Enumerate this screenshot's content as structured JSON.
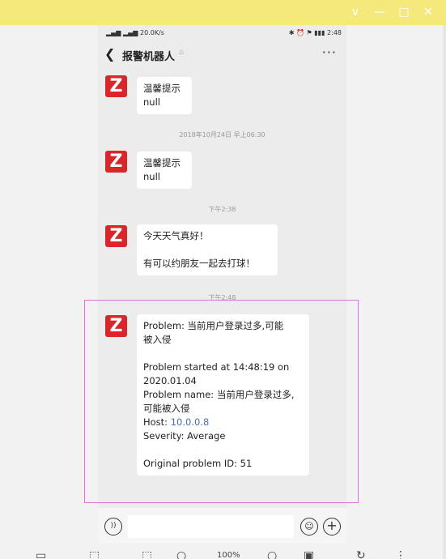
{
  "window": {
    "controls": [
      "∨",
      "—",
      "□",
      "✕"
    ]
  },
  "status_bar": {
    "left": "▂▄▆ ▂▄▆ 20.0K/s",
    "right": "✱ ⏰ ⚑ ▮▮▮ 2:48"
  },
  "chat": {
    "back": "❮",
    "title": "报警机器人",
    "mute_icon": "⌂",
    "more": "···",
    "avatar_letter": "Z"
  },
  "messages": [
    {
      "lines": [
        "温馨提示",
        "null"
      ]
    },
    {
      "timestamp": "2018年10月24日 早上06:30"
    },
    {
      "lines": [
        "温馨提示",
        "null"
      ]
    },
    {
      "timestamp": "下午2:38"
    },
    {
      "lines": [
        "今天天气真好！",
        "",
        "有可以约朋友一起去打球！"
      ]
    },
    {
      "timestamp": "下午2:48"
    },
    {
      "l1": "Problem: 当前用户登录过多,可能",
      "l2": "被入侵",
      "l3": "Problem started at 14:48:19 on",
      "l4": "2020.01.04",
      "l5": "Problem name: 当前用户登录过多,",
      "l6": "可能被入侵",
      "host_label": "Host: ",
      "host_value": "10.0.0.8",
      "severity": "Severity: Average",
      "original_id": "Original problem ID: 51"
    }
  ],
  "input_bar": {
    "voice_icon": "))",
    "emoji_icon": "☺",
    "plus_icon": "+"
  },
  "toolbar": {
    "zoom": "100%"
  }
}
